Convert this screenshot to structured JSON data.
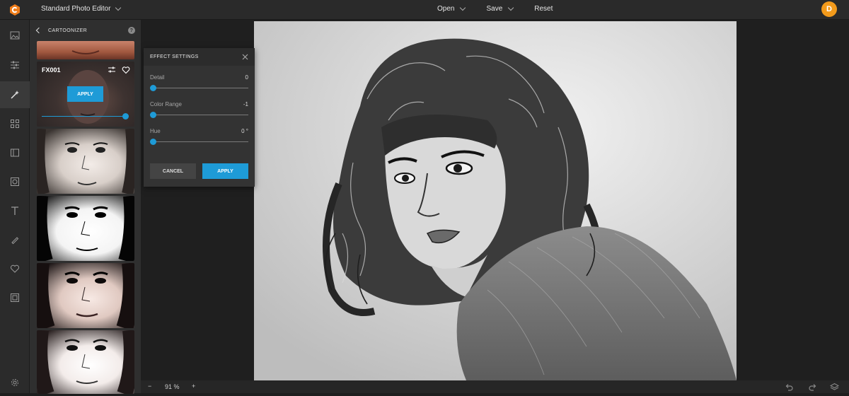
{
  "header": {
    "app_title": "Standard Photo Editor",
    "menu": {
      "open": "Open",
      "save": "Save",
      "reset": "Reset"
    },
    "avatar_initial": "D"
  },
  "rail": {
    "items": [
      "image-icon",
      "adjust-icon",
      "effects-icon",
      "grid-icon",
      "frame-icon",
      "vignette-icon",
      "text-icon",
      "draw-icon",
      "heart-icon",
      "border-icon",
      "settings-icon"
    ],
    "active": "effects-icon"
  },
  "panel": {
    "title": "CARTOONIZER",
    "help": "?",
    "selected_effect": {
      "label": "FX001",
      "apply_label": "APPLY",
      "intensity": 1.0
    }
  },
  "dialog": {
    "title": "EFFECT SETTINGS",
    "settings": [
      {
        "label": "Detail",
        "value": "0"
      },
      {
        "label": "Color Range",
        "value": "-1"
      },
      {
        "label": "Hue",
        "value": "0 °"
      }
    ],
    "cancel_label": "CANCEL",
    "apply_label": "APPLY"
  },
  "footer": {
    "zoom_minus": "−",
    "zoom_value": "91 %",
    "zoom_plus": "+"
  },
  "colors": {
    "accent": "#1e9bd7",
    "avatar": "#f29a1b",
    "logo": "#f07d1a"
  }
}
